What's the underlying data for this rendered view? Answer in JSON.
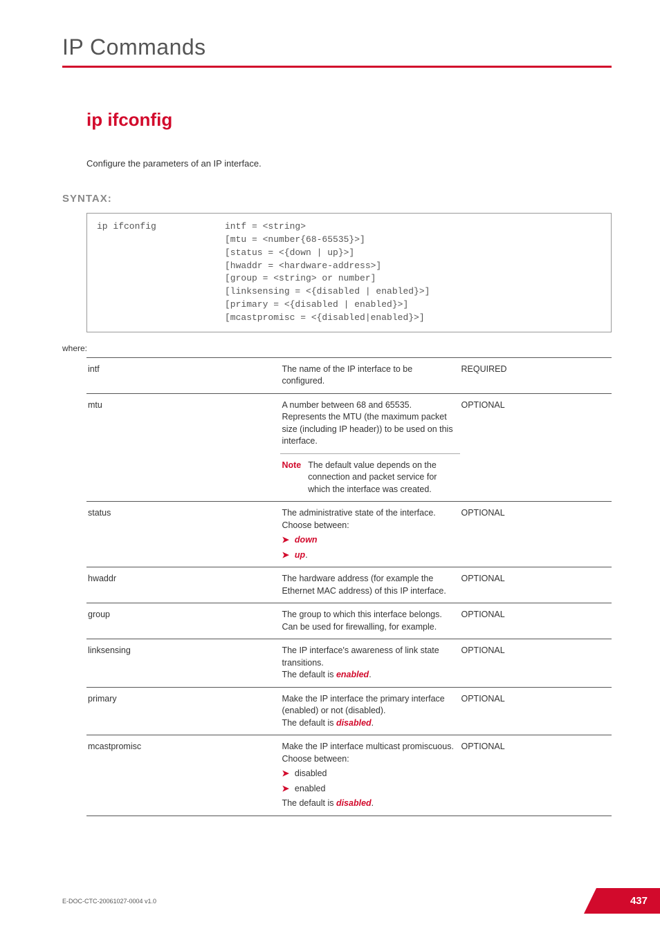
{
  "header": {
    "title": "IP Commands"
  },
  "command": {
    "title": "ip ifconfig",
    "description": "Configure the parameters of an IP interface."
  },
  "syntax": {
    "label": "SYNTAX:",
    "cmd": "ip ifconfig",
    "lines": [
      "intf = <string>",
      "[mtu = <number{68-65535}>]",
      "[status = <{down | up}>]",
      "[hwaddr = <hardware-address>]",
      "[group = <string> or number]",
      "[linksensing = <{disabled | enabled}>]",
      "[primary = <{disabled | enabled}>]",
      "[mcastpromisc = <{disabled|enabled}>]"
    ]
  },
  "where": "where:",
  "required": "REQUIRED",
  "optional": "OPTIONAL",
  "params": {
    "intf": {
      "name": "intf",
      "desc": "The name of the IP interface to be configured."
    },
    "mtu": {
      "name": "mtu",
      "desc": "A number between 68 and 65535.\nRepresents the MTU (the maximum packet size (including IP header)) to be used on this interface.",
      "noteLabel": "Note",
      "note": "The default value depends on the connection and packet service for which the interface was created."
    },
    "status": {
      "name": "status",
      "desc": "The administrative state of the interface.\nChoose between:",
      "opt1": "down",
      "opt2": "up",
      "opt2suffix": "."
    },
    "hwaddr": {
      "name": "hwaddr",
      "desc": "The hardware address (for example the Ethernet MAC address) of this IP interface."
    },
    "group": {
      "name": "group",
      "desc": "The group to which this interface belongs. Can be used for firewalling, for example."
    },
    "linksensing": {
      "name": "linksensing",
      "desc": "The IP interface's awareness of link state transitions.",
      "defaultPrefix": "The default is ",
      "defaultVal": "enabled",
      "defaultSuffix": "."
    },
    "primary": {
      "name": "primary",
      "desc": "Make the IP interface the primary interface (enabled) or not (disabled).",
      "defaultPrefix": "The default is ",
      "defaultVal": "disabled",
      "defaultSuffix": "."
    },
    "mcast": {
      "name": "mcastpromisc",
      "desc": "Make the IP interface multicast promiscuous.\nChoose between:",
      "opt1": "disabled",
      "opt2": "enabled",
      "defaultPrefix": "The default is ",
      "defaultVal": "disabled",
      "defaultSuffix": "."
    }
  },
  "footer": {
    "doc": "E-DOC-CTC-20061027-0004 v1.0",
    "page": "437"
  }
}
